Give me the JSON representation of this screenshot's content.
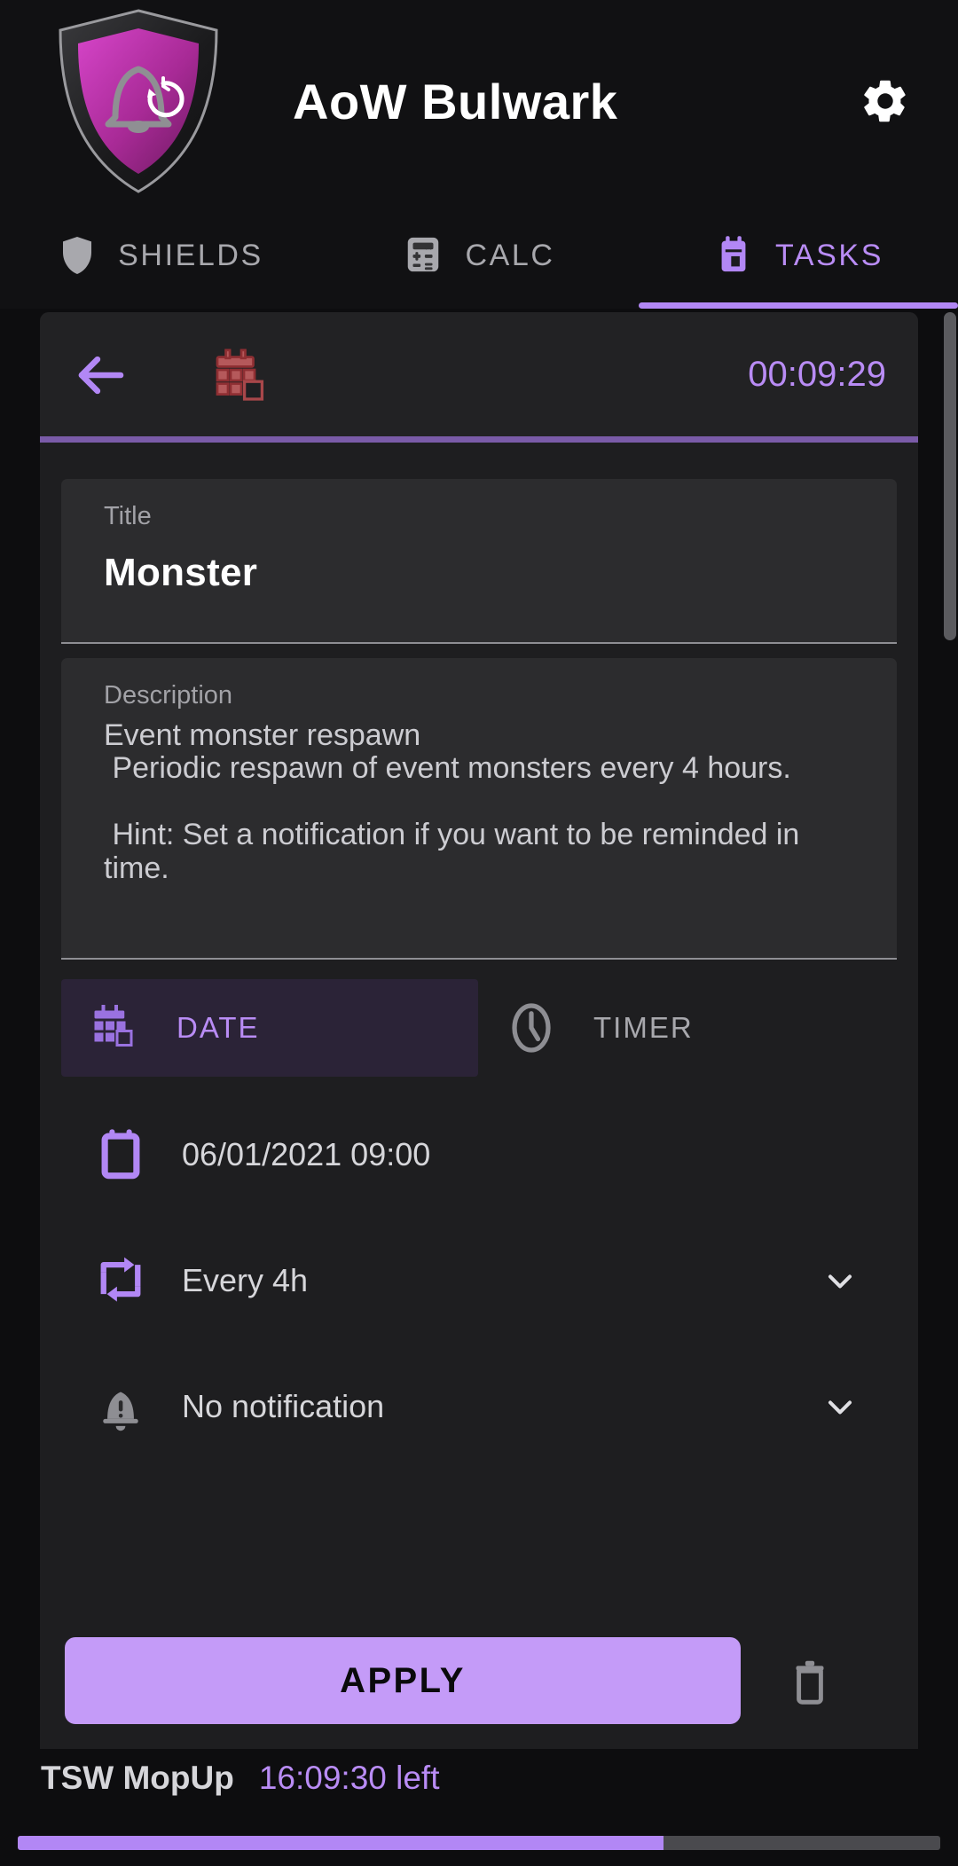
{
  "header": {
    "title": "AoW Bulwark",
    "logo_icon": "shield-bell-clock-logo",
    "settings_icon": "gear-icon"
  },
  "tabs": [
    {
      "label": "SHIELDS",
      "icon": "shield-icon",
      "active": false
    },
    {
      "label": "CALC",
      "icon": "calculator-icon",
      "active": false
    },
    {
      "label": "TASKS",
      "icon": "calendar-icon",
      "active": true
    }
  ],
  "editor": {
    "back_icon": "arrow-left-icon",
    "task_type_icon": "calendar-event-icon",
    "timer": "00:09:29",
    "title": {
      "label": "Title",
      "value": "Monster",
      "placeholder": "Title"
    },
    "description": {
      "label": "Description",
      "value": "Event monster respawn\n Periodic respawn of event monsters every 4 hours.\n\n Hint: Set a notification if you want to be reminded in time.",
      "placeholder": "Description"
    },
    "mode_tabs": [
      {
        "label": "DATE",
        "icon": "calendar-multi-icon",
        "active": true
      },
      {
        "label": "TIMER",
        "icon": "clock-icon",
        "active": false
      }
    ],
    "rows": [
      {
        "label": "06/01/2021 09:00",
        "icon": "calendar-outline-icon",
        "chevron": false
      },
      {
        "label": "Every 4h",
        "icon": "repeat-icon",
        "chevron": true
      },
      {
        "label": "No notification",
        "icon": "bell-off-icon",
        "chevron": true
      }
    ],
    "apply_label": "APPLY",
    "delete_icon": "trash-icon"
  },
  "status": {
    "name": "TSW MopUp",
    "time_left": "16:09:30 left",
    "progress_percent": 70
  },
  "colors": {
    "accent": "#b287f5",
    "accent_light": "#c49bf8",
    "accent_text": "#b98cf5",
    "background": "#0d0d0f",
    "surface": "#1e1e20",
    "field": "#2c2c2e",
    "muted_text": "#a8a8ad",
    "task_type": "#b5595b"
  }
}
